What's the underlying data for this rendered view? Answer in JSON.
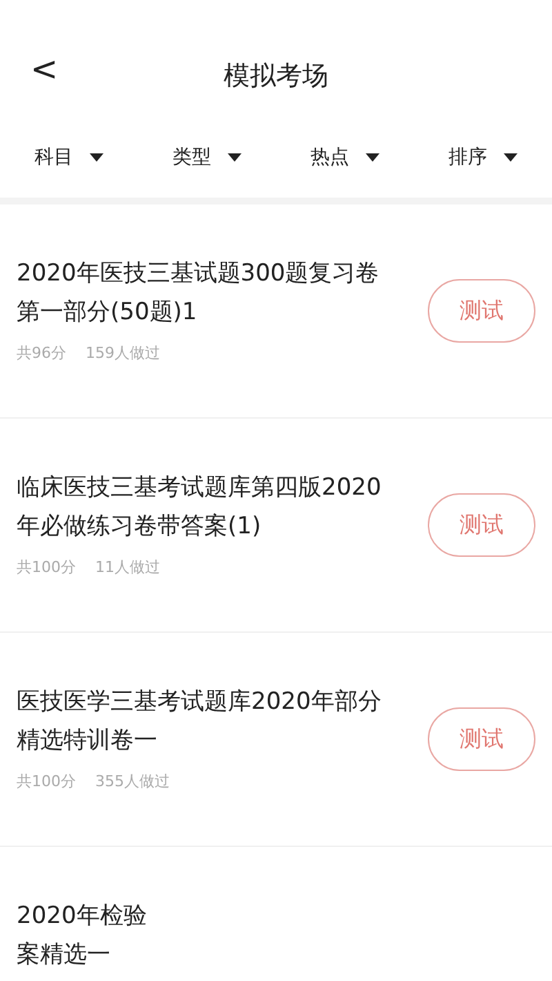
{
  "header": {
    "back": "<",
    "title": "模拟考场"
  },
  "filters": [
    {
      "label": "科目"
    },
    {
      "label": "类型"
    },
    {
      "label": "热点"
    },
    {
      "label": "排序"
    }
  ],
  "exams": [
    {
      "title_lines": [
        "2020年医技三基试题300题复习卷",
        "第一部分(50题)1"
      ],
      "score": "共96分",
      "takers": "159人做过",
      "button": "测试"
    },
    {
      "title_lines": [
        "临床医技三基考试题库第四版2020",
        "年必做练习卷带答案(1)"
      ],
      "score": "共100分",
      "takers": "11人做过",
      "button": "测试"
    },
    {
      "title_lines": [
        "医技医学三基考试题库2020年部分",
        "精选特训卷一"
      ],
      "score": "共100分",
      "takers": "355人做过",
      "button": "测试"
    },
    {
      "title_lines": [
        "2020年检验",
        "案精选一"
      ]
    }
  ]
}
